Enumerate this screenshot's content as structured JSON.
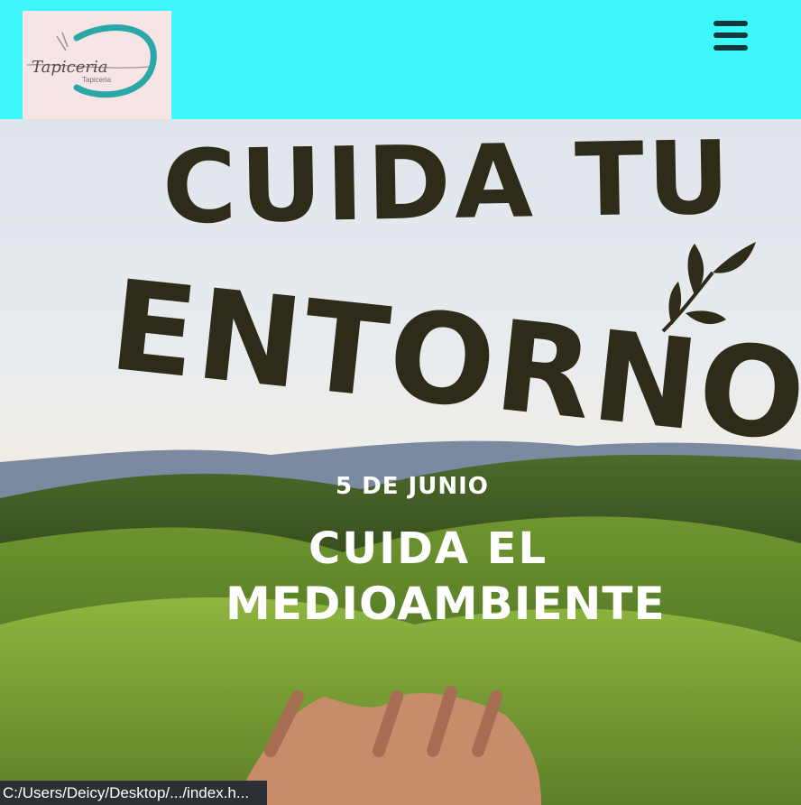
{
  "header": {
    "logo_text": "Tapiceria",
    "logo_subtext": "Tapiceria",
    "menu_icon": "hamburger-menu-icon",
    "background": "#3ef7fb"
  },
  "hero": {
    "headline_line1": "Cuida tu",
    "headline_line2": "entorno",
    "date": "5 de junio",
    "subheading_line1": "Cuida el",
    "subheading_line2": "medioambiente",
    "headline_color": "#2e2b18",
    "subheading_color": "#ffffff"
  },
  "status_bar": {
    "url": "C:/Users/Deicy/Desktop/.../index.h..."
  }
}
